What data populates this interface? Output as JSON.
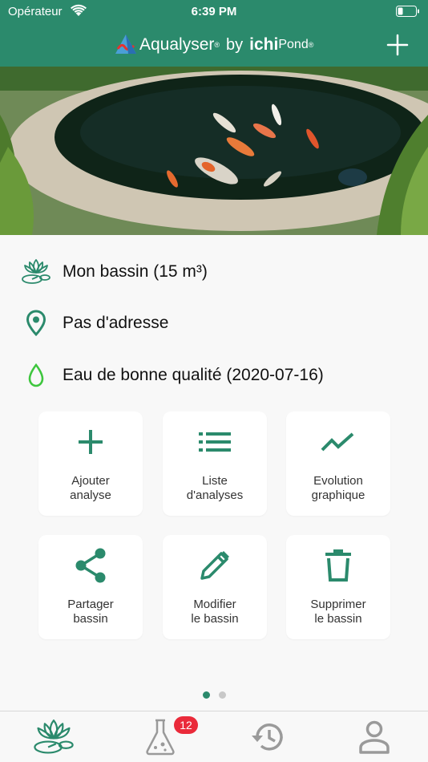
{
  "status_bar": {
    "carrier": "Opérateur",
    "time": "6:39 PM"
  },
  "header": {
    "brand_name": "Aqualyser",
    "brand_reg": "®",
    "by": "by",
    "partner_ichi": "ichi",
    "partner_pond": "Pond",
    "partner_reg": "®",
    "add_icon": "plus-icon"
  },
  "hero": {
    "description_icon": "koi-pond-photo"
  },
  "pond": {
    "name": "Mon bassin (15 m³)",
    "address": "Pas d'adresse",
    "quality": "Eau de bonne qualité (2020-07-16)"
  },
  "actions": [
    {
      "label": "Ajouter\nanalyse",
      "icon": "plus-icon"
    },
    {
      "label": "Liste\nd'analyses",
      "icon": "list-icon"
    },
    {
      "label": "Evolution\ngraphique",
      "icon": "trend-icon"
    },
    {
      "label": "Partager\nbassin",
      "icon": "share-icon"
    },
    {
      "label": "Modifier\nle bassin",
      "icon": "pencil-icon"
    },
    {
      "label": "Supprimer\nle bassin",
      "icon": "trash-icon"
    }
  ],
  "pager": {
    "pages": 2,
    "active": 1
  },
  "tabbar": {
    "tabs": [
      {
        "icon": "lotus-icon",
        "active": true
      },
      {
        "icon": "flask-icon",
        "badge": "12"
      },
      {
        "icon": "history-icon"
      },
      {
        "icon": "user-icon"
      }
    ]
  },
  "colors": {
    "primary": "#2b8a6c",
    "quality_green": "#3ec63e",
    "badge_red": "#ea2a3a"
  }
}
